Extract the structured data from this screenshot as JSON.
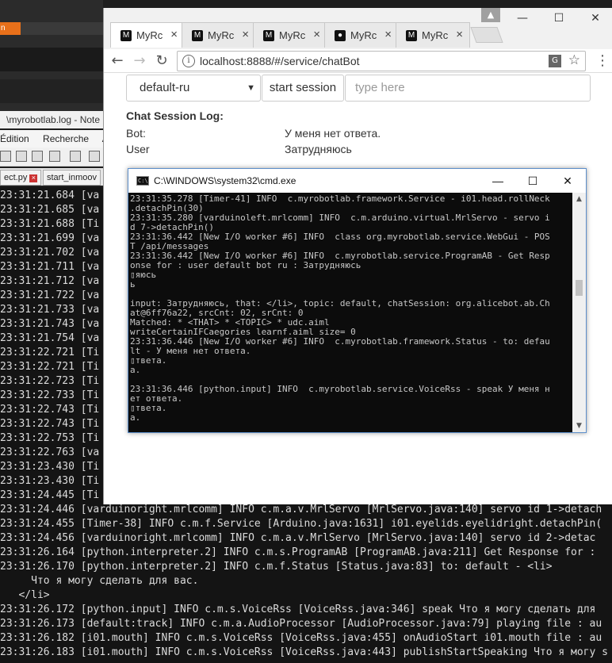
{
  "background": {
    "orange_tab_label": "n",
    "notepad_title": "\\myrobotlab.log - Note",
    "notepad_menu": [
      "Édition",
      "Recherche",
      "A"
    ],
    "notepad_tabs": [
      "ect.py",
      "start_inmoov"
    ],
    "log_lines": [
      "23:31:21.684 [va",
      "23:31:21.685 [va",
      "23:31:21.688 [Ti",
      "23:31:21.699 [va",
      "23:31:21.702 [va",
      "23:31:21.711 [va",
      "23:31:21.712 [va",
      "23:31:21.722 [va",
      "23:31:21.733 [va",
      "23:31:21.743 [va",
      "23:31:21.754 [va",
      "23:31:22.721 [Ti",
      "23:31:22.721 [Ti",
      "23:31:22.723 [Ti",
      "23:31:22.733 [Ti",
      "23:31:22.743 [Ti",
      "23:31:22.743 [Ti",
      "23:31:22.753 [Ti",
      "23:31:22.763 [va",
      "23:31:23.430 [Ti",
      "23:31:23.430 [Ti",
      "23:31:24.445 [Ti",
      "23:31:24.446 [varduinoright.mrlcomm] INFO c.m.a.v.MrlServo [MrlServo.java:140] servo id 1->detach",
      "23:31:24.455 [Timer-38] INFO c.m.f.Service [Arduino.java:1631] i01.eyelids.eyelidright.detachPin(",
      "23:31:24.456 [varduinoright.mrlcomm] INFO c.m.a.v.MrlServo [MrlServo.java:140] servo id 2->detac",
      "23:31:26.164 [python.interpreter.2] INFO c.m.s.ProgramAB [ProgramAB.java:211] Get Response for :",
      "23:31:26.170 [python.interpreter.2] INFO c.m.f.Status [Status.java:83] to: default - <li>",
      "     Что я могу сделать для вас.",
      "   </li>",
      "23:31:26.172 [python.input] INFO c.m.s.VoiceRss [VoiceRss.java:346] speak Что я могу сделать для",
      "23:31:26.173 [default:track] INFO c.m.a.AudioProcessor [AudioProcessor.java:79] playing file : au",
      "23:31:26.182 [i01.mouth] INFO c.m.s.VoiceRss [VoiceRss.java:455] onAudioStart i01.mouth file : au",
      "23:31:26.183 [i01.mouth] INFO c.m.s.VoiceRss [VoiceRss.java:443] publishStartSpeaking Что я могу s"
    ]
  },
  "browser": {
    "tabs": [
      {
        "label": "MyRc",
        "icon": "myrobotlab-icon",
        "active": true
      },
      {
        "label": "MyRc",
        "icon": "myrobotlab-icon",
        "active": false
      },
      {
        "label": "MyRc",
        "icon": "myrobotlab-icon",
        "active": false
      },
      {
        "label": "MyRc",
        "icon": "github-icon",
        "active": false
      },
      {
        "label": "MyRc",
        "icon": "myrobotlab-icon",
        "active": false
      }
    ],
    "url": "localhost:8888/#/service/chatBot"
  },
  "chat": {
    "bot_select": "default-ru",
    "start_button": "start session",
    "input_placeholder": "type here",
    "log_title": "Chat Session Log:",
    "rows": [
      {
        "speaker": "Bot:",
        "text": "У меня нет ответа."
      },
      {
        "speaker": "User",
        "text": "Затрудняюсь"
      }
    ]
  },
  "cmd": {
    "title": "C:\\WINDOWS\\system32\\cmd.exe",
    "lines": [
      "23:31:35.278 [Timer-41] INFO  c.myrobotlab.framework.Service - i01.head.rollNeck",
      ".detachPin(30)",
      "23:31:35.280 [varduinoleft.mrlcomm] INFO  c.m.arduino.virtual.MrlServo - servo i",
      "d 7->detachPin()",
      "23:31:36.442 [New I/O worker #6] INFO  class org.myrobotlab.service.WebGui - POS",
      "T /api/messages",
      "23:31:36.442 [New I/O worker #6] INFO  c.myrobotlab.service.ProgramAB - Get Resp",
      "onse for : user default bot ru : Затрудняюсь",
      "▯яюсь",
      "ь",
      "",
      "input: Затрудняюсь, that: </li>, topic: default, chatSession: org.alicebot.ab.Ch",
      "at@6ff76a22, srcCnt: 02, srCnt: 0",
      "Matched: * <THAT> * <TOPIC> * udc.aiml",
      "writeCertainIFCaegories learnf.aiml size= 0",
      "23:31:36.446 [New I/O worker #6] INFO  c.myrobotlab.framework.Status - to: defau",
      "lt - У меня нет ответа.",
      "▯твета.",
      "а.",
      "",
      "23:31:36.446 [python.input] INFO  c.myrobotlab.service.VoiceRss - speak У меня н",
      "ет ответа.",
      "▯твета.",
      "а."
    ]
  }
}
